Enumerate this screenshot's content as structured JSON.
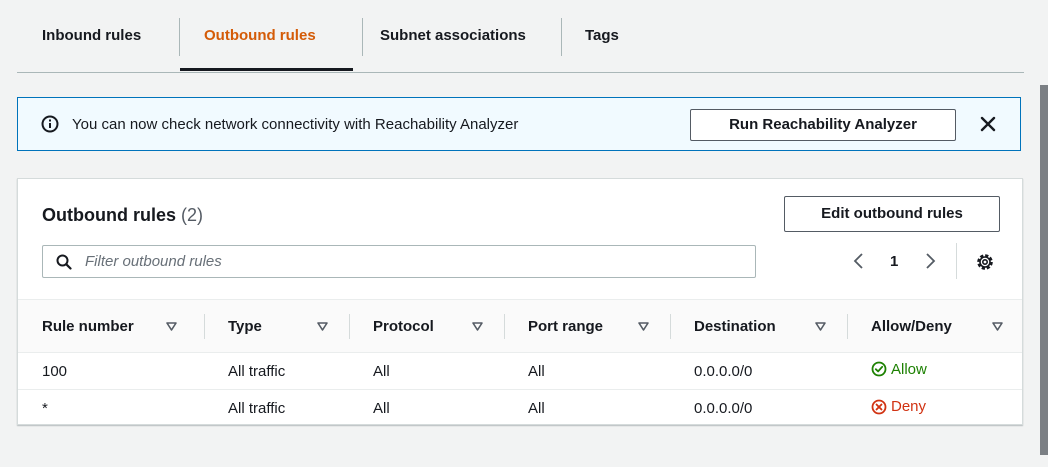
{
  "tabs": [
    {
      "label": "Inbound rules",
      "active": false
    },
    {
      "label": "Outbound rules",
      "active": true
    },
    {
      "label": "Subnet associations",
      "active": false
    },
    {
      "label": "Tags",
      "active": false
    }
  ],
  "flash": {
    "icon": "info-icon",
    "message": "You can now check network connectivity with Reachability Analyzer",
    "button_label": "Run Reachability Analyzer",
    "close_icon": "close-icon",
    "color": "#0073bb"
  },
  "panel": {
    "title": "Outbound rules",
    "count": "(2)",
    "edit_button": "Edit outbound rules",
    "search_placeholder": "Filter outbound rules",
    "search_value": "",
    "page": "1"
  },
  "table": {
    "columns": [
      "Rule number",
      "Type",
      "Protocol",
      "Port range",
      "Destination",
      "Allow/Deny"
    ],
    "rows": [
      {
        "rule_number": "100",
        "type": "All traffic",
        "protocol": "All",
        "port_range": "All",
        "destination": "0.0.0.0/0",
        "action": "Allow",
        "action_icon": "check-circle-icon"
      },
      {
        "rule_number": "*",
        "type": "All traffic",
        "protocol": "All",
        "port_range": "All",
        "destination": "0.0.0.0/0",
        "action": "Deny",
        "action_icon": "x-circle-icon"
      }
    ]
  },
  "colors": {
    "active_tab": "#d45b07",
    "allow": "#1d8102",
    "deny": "#d13212"
  }
}
